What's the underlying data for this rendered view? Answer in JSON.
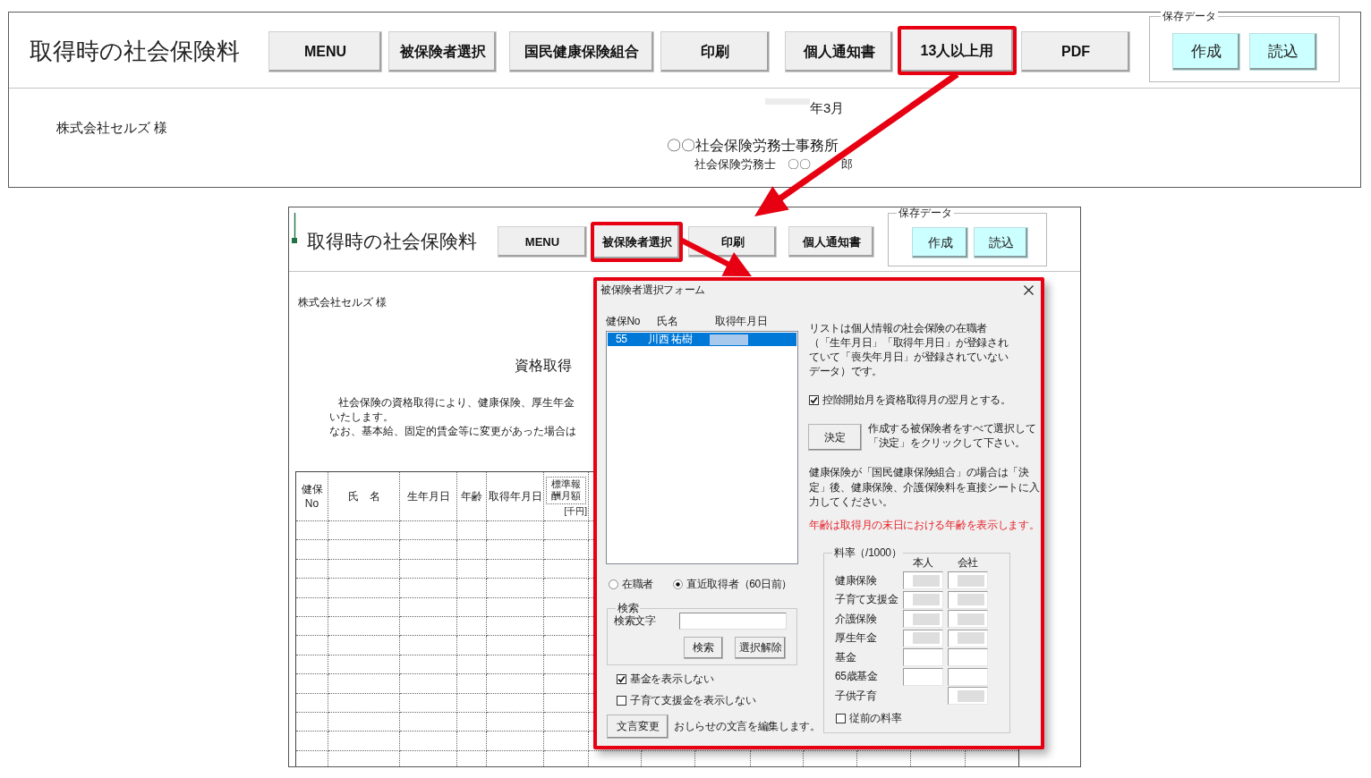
{
  "main_sheet": {
    "title": "取得時の社会保険料",
    "toolbar": [
      {
        "label": "MENU",
        "highlighted": false
      },
      {
        "label": "被保険者選択",
        "highlighted": false
      },
      {
        "label": "国民健康保険組合",
        "highlighted": false
      },
      {
        "label": "印刷",
        "highlighted": false
      },
      {
        "label": "個人通知書",
        "highlighted": false
      },
      {
        "label": "13人以上用",
        "highlighted": true
      },
      {
        "label": "PDF",
        "highlighted": false
      }
    ],
    "saved_data": {
      "label": "保存データ",
      "buttons": [
        "作成",
        "読込"
      ]
    },
    "client": "株式会社セルズ 様",
    "date": {
      "year_masked": true,
      "text": "年3月"
    },
    "office": "〇〇社会保険労務士事務所",
    "signer": [
      "社会保険労務士　〇〇",
      "郎"
    ]
  },
  "inset_sheet": {
    "title": "取得時の社会保険料",
    "toolbar": [
      {
        "label": "MENU",
        "highlighted": false
      },
      {
        "label": "被保険者選択",
        "highlighted": true
      },
      {
        "label": "印刷",
        "highlighted": false
      },
      {
        "label": "個人通知書",
        "highlighted": false
      }
    ],
    "saved_data": {
      "label": "保存データ",
      "buttons": [
        "作成",
        "読込"
      ]
    },
    "client": "株式会社セルズ 様",
    "heading": "資格取得",
    "notice_lines": [
      "社会保険の資格取得により、健康保険、厚生年金",
      "いたします。",
      "なお、基本給、固定的賃金等に変更があった場合は"
    ],
    "table": {
      "columns": [
        {
          "label": "健保No"
        },
        {
          "label": "氏　名"
        },
        {
          "label": "生年月日"
        },
        {
          "label": "年齢"
        },
        {
          "label": "取得年月日"
        },
        {
          "label": "標準報酬月額",
          "unit": "[千円]"
        }
      ]
    }
  },
  "dialog": {
    "highlighted": true,
    "title": "被保険者選択フォーム",
    "list": {
      "columns": [
        "健保No",
        "氏名",
        "取得年月日"
      ],
      "rows": [
        {
          "no": "55",
          "name": "川西 祐樹",
          "date_masked": true,
          "selected": true
        }
      ]
    },
    "filter": [
      {
        "label": "在職者",
        "selected": false
      },
      {
        "label": "直近取得者（60日前）",
        "selected": true
      }
    ],
    "search": {
      "label": "検索",
      "field_label": "検索文字",
      "buttons": [
        "検索",
        "選択解除"
      ]
    },
    "options": [
      {
        "label": "基金を表示しない",
        "checked": true
      },
      {
        "label": "子育て支援金を表示しない",
        "checked": false
      }
    ],
    "edit_button": "文言変更",
    "edit_hint": "おしらせの文言を編集します。",
    "info": "リストは個人情報の社会保険の在職者（「生年月日」「取得年月日」が登録されていて「喪失年月日」が登録されていないデータ）です。",
    "deduction_option": {
      "label": "控除開始月を資格取得月の翌月とする。",
      "checked": true
    },
    "confirm_button": "決定",
    "confirm_hint": "作成する被保険者をすべて選択して「決定」をクリックして下さい。",
    "note": "健康保険が「国民健康保険組合」の場合は「決定」後、健康保険、介護保険料を直接シートに入力してください。",
    "warning": "年齢は取得月の末日における年齢を表示します。",
    "rates": {
      "label": "料率（/1000）",
      "columns": [
        "本人",
        "会社"
      ],
      "rows": [
        {
          "label": "健康保険",
          "employee": {
            "masked": true
          },
          "employer": {
            "masked": true
          }
        },
        {
          "label": "子育て支援金",
          "employee": {
            "masked": true
          },
          "employer": {
            "masked": true
          }
        },
        {
          "label": "介護保険",
          "employee": {
            "masked": true
          },
          "employer": {
            "masked": true
          }
        },
        {
          "label": "厚生年金",
          "employee": {
            "masked": true
          },
          "employer": {
            "masked": true
          }
        },
        {
          "label": "基金",
          "employee": {
            "masked": false
          },
          "employer": {
            "masked": false
          }
        },
        {
          "label": "65歳基金",
          "employee": {
            "masked": false
          },
          "employer": {
            "masked": false
          }
        },
        {
          "label": "子供子育",
          "employer": {
            "masked": true
          }
        }
      ],
      "previous_rates": {
        "label": "従前の料率",
        "checked": false
      }
    }
  }
}
